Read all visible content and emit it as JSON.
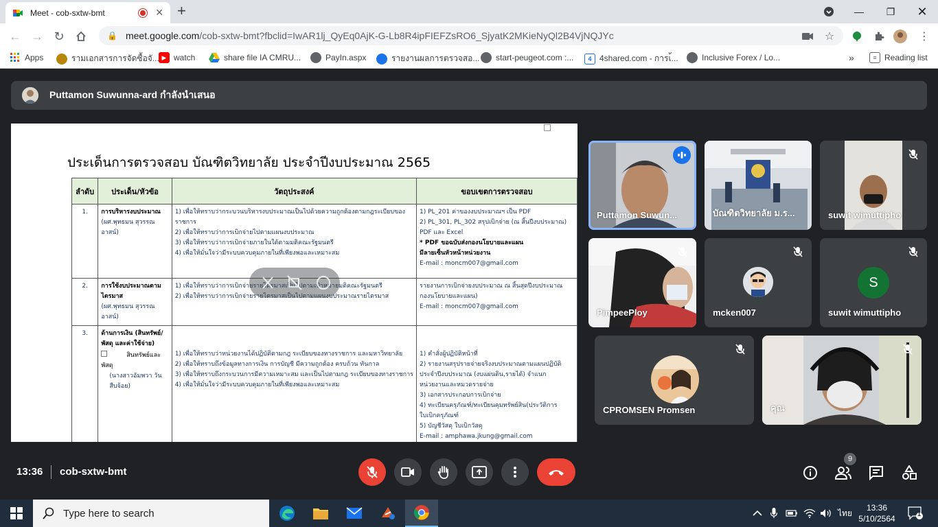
{
  "browser": {
    "tab_title": "Meet - cob-sxtw-bmt",
    "url_host": "meet.google.com",
    "url_path": "/cob-sxtw-bmt?fbclid=IwAR1lj_QyEq0AjK-G-Lb8R4ipFIEFZsRO6_SjyatK2MKieNyQl2B4VjNQJYc",
    "bookmarks": [
      {
        "label": "Apps",
        "color": "#ea4335"
      },
      {
        "label": "รามเอกสารการจัดซื้อจั...",
        "color": "#b8860b"
      },
      {
        "label": "watch",
        "color": "#ff0000"
      },
      {
        "label": "share file IA CMRU...",
        "color": "#34a853"
      },
      {
        "label": "PayIn.aspx",
        "color": "#5f6368"
      },
      {
        "label": "รายงานผลการตรวจสอ...",
        "color": "#1a73e8"
      },
      {
        "label": "start-peugeot.com :...",
        "color": "#5f6368"
      },
      {
        "label": "4shared.com - การเ้...",
        "color": "#1a73e8"
      },
      {
        "label": "Inclusive Forex / Lo...",
        "color": "#5f6368"
      }
    ],
    "reading_list": "Reading list"
  },
  "meet": {
    "presenter_banner": "Puttamon Suwunna-ard กำลังนำเสนอ",
    "meeting_time": "13:36",
    "meeting_code": "cob-sxtw-bmt",
    "participant_count": "9",
    "slide": {
      "title": "ประเด็นการตรวจสอบ บัณฑิตวิทยาลัย  ประจำปีงบประมาณ 2565",
      "headers": [
        "ลำดับ",
        "ประเด็น/หัวข้อ",
        "วัตถุประสงค์",
        "ขอบเขตการตรวจสอบ"
      ],
      "rows": [
        {
          "no": "1.",
          "topic": "การบริหารงบประมาณ",
          "owner": "(ผศ.พุทธมน สุวรรณอาสน์)",
          "objectives": [
            "1)    เพื่อให้ทราบว่ากระบวนบริหารงบประมาณเป็นไปด้วยความถูกต้องตามกฎระเบียบของ",
            "       ราชการ",
            "2)    เพื่อให้ทราบว่าการเบิกจ่ายไปตามแผนงบประมาณ",
            "3)    เพื่อให้ทราบว่าการเบิกจ่ายภายในใต้ตามมติคณะรัฐมนตรี",
            "4)    เพื่อให้มั่นใจว่ามีระบบควบคุมภายในที่เพียงพอและเหมาะสม"
          ],
          "scope": [
            "1)   PL_201 ค่าของงบประมาณฯ  เป็น PDF",
            "2)   PL_301, PL_302 สรุปเบิกจ่าย (ณ สิ้นปีงบประมาณ)",
            "      PDF และ Excel",
            "      * PDF ขอฉบับส่งกองนโยบายและแผน",
            "        มีลายเซ็นหัวหน้าหน่วยงาน",
            "E-mail : moncm007@gmail.com"
          ]
        },
        {
          "no": "2.",
          "topic": "การใช้งบประมาณตามไตรมาส",
          "owner": "(ผศ.พุทธมน สุวรรณอาสน์)",
          "objectives": [
            "1)    เพื่อให้ทราบว่าการเบิกจ่ายรายไตรมาสเป็นไปตามเป้าหมายมติคณะรัฐมนตรี",
            "2)    เพื่อให้ทราบว่าการเบิกจ่ายรายไตรมาสเป็นไปตามแผนงบประมาณรายไตรมาส"
          ],
          "scope": [
            "รายงานการเบิกจ่ายงบประมาณ ณ สิ้นสุดปีงบประมาณ",
            "กองนโยบายและแผน)",
            "E-mail : moncm007@gmail.com"
          ]
        },
        {
          "no": "3.",
          "topic": "ด้านการเงิน (สินทรัพย์/พัสดุ และค่าใช้จ่าย)",
          "sub": "สินทรัพย์และพัสดุ",
          "owner": "(นางสาวอัมพวา วันสืบจ้อย)",
          "objectives": [
            "1)    เพื่อให้ทราบว่าหน่วยงานได้ปฏิบัติตามกฎ ระเบียบของทางราชการ และมหาวิทยาลัย",
            "2)    เพื่อให้ทราบถึงข้อมูลทางการเงิน การบัญชี มีความถูกต้อง ครบถ้วน ทันกาล",
            "3)    เพื่อให้ทราบถึงกระบวนการมีความเหมาะสม และเป็นไปตามกฎ ระเบียบของทางราชการ",
            "4)    เพื่อให้มั่นใจว่ามีระบบควบคุมภายในที่เพียงพอและเหมาะสม"
          ],
          "scope": [
            "1)   คำสั่งผู้ปฏิบัติหน้าที่",
            "2)   รายงานสรุปรายจ่ายจริงงบประมาณตามแผนปฏิบัติ",
            "      ประจำปีงบประมาณ (งบแผ่นดิน,รายได้) จำแนก",
            "      หน่วยงานและหมวดรายจ่าย",
            "3)   เอกสารประกอบการเบิกจ่าย",
            "4)   ทะเบียนครุภัณฑ์/ทะเบียนคุมทรัพย์สิน(ประวัติการ",
            "      ใบเบิกครุภัณฑ์",
            "5)   บัญชีวัสดุ ใบเบิกวัสดุ",
            "E-mail : amphawa.jkung@gmail.com"
          ]
        }
      ]
    },
    "participants": [
      {
        "name": "Puttamon Suwun...",
        "muted": false,
        "speaking": true
      },
      {
        "name": "บัณฑิตวิทยาลัย ม.ร...",
        "muted": false
      },
      {
        "name": "suwit wimuttipho",
        "muted": true
      },
      {
        "name": "PimpeePloy",
        "muted": true
      },
      {
        "name": "mcken007",
        "muted": true
      },
      {
        "name": "suwit wimuttipho",
        "muted": true,
        "initial": "S",
        "avatar_color": "#137333"
      },
      {
        "name": "CPROMSEN Promsen",
        "muted": true
      },
      {
        "name": "คุณ",
        "muted": true
      }
    ]
  },
  "taskbar": {
    "search_placeholder": "Type here to search",
    "time": "13:36",
    "date": "5/10/2564",
    "language": "ไทย",
    "notification_count": "1"
  }
}
